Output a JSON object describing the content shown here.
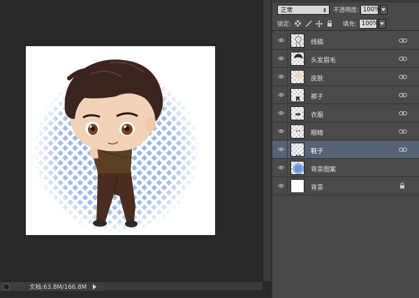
{
  "status_bar": {
    "doc_info": "文档:63.8M/166.8M"
  },
  "layers_panel": {
    "blend_mode": "正常",
    "opacity_label": "不透明度:",
    "opacity_value": "100%",
    "lock_label": "锁定:",
    "fill_label": "填充:",
    "fill_value": "100%",
    "layers": [
      {
        "name": "线稿",
        "linked": true,
        "selected": false,
        "thumb": "lineart"
      },
      {
        "name": "头发眉毛",
        "linked": true,
        "selected": false,
        "thumb": "hair"
      },
      {
        "name": "皮肤",
        "linked": true,
        "selected": false,
        "thumb": "skin"
      },
      {
        "name": "裤子",
        "linked": true,
        "selected": false,
        "thumb": "pants"
      },
      {
        "name": "衣服",
        "linked": true,
        "selected": false,
        "thumb": "shirt"
      },
      {
        "name": "眼睛",
        "linked": true,
        "selected": false,
        "thumb": "eyes"
      },
      {
        "name": "鞋子",
        "linked": true,
        "selected": true,
        "thumb": "shoes"
      },
      {
        "name": "背景图案",
        "linked": false,
        "selected": false,
        "thumb": "pattern"
      },
      {
        "name": "背景",
        "linked": false,
        "locked": true,
        "selected": false,
        "thumb": "white"
      }
    ]
  },
  "colors": {
    "workspace": "#282828",
    "panel": "#494949",
    "selected_layer": "#566275",
    "pattern_blue": "#7fa3dc",
    "hair": "#3b2320",
    "shirt": "#5c3f22",
    "pants": "#4a2d1e"
  }
}
